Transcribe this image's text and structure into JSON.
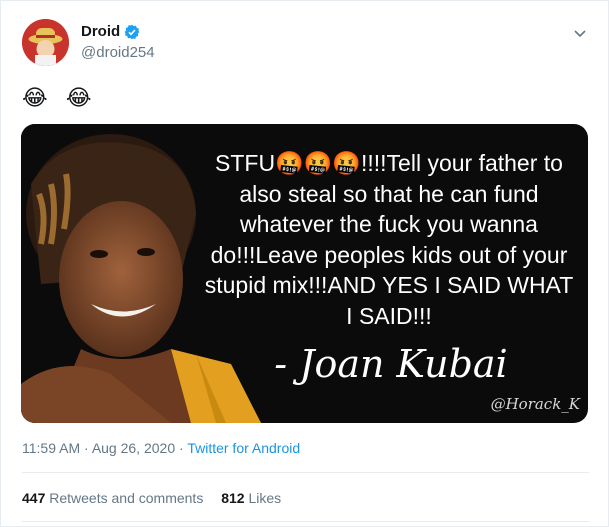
{
  "tweet": {
    "display_name": "Droid",
    "handle": "@droid254",
    "text_emoji": "😂 😂",
    "verified": true,
    "icons": [
      "verified-badge-icon",
      "chevron-down-icon"
    ],
    "accent_color": "#1da1f2"
  },
  "media": {
    "quote_text": "STFU🤬🤬🤬!!!!Tell your father to also steal so that he can fund whatever the fuck you wanna do!!!Leave peoples kids out of your stupid mix!!!AND YES I SAID WHAT I SAID!!!",
    "author": "- Joan Kubai",
    "watermark": "@Horack_K"
  },
  "meta": {
    "time": "11:59 AM",
    "separator1": "·",
    "date": "Aug 26, 2020",
    "separator2": "·",
    "source": "Twitter for Android"
  },
  "stats": {
    "retweets_count": "447",
    "retweets_label": "Retweets and comments",
    "likes_count": "812",
    "likes_label": "Likes"
  }
}
